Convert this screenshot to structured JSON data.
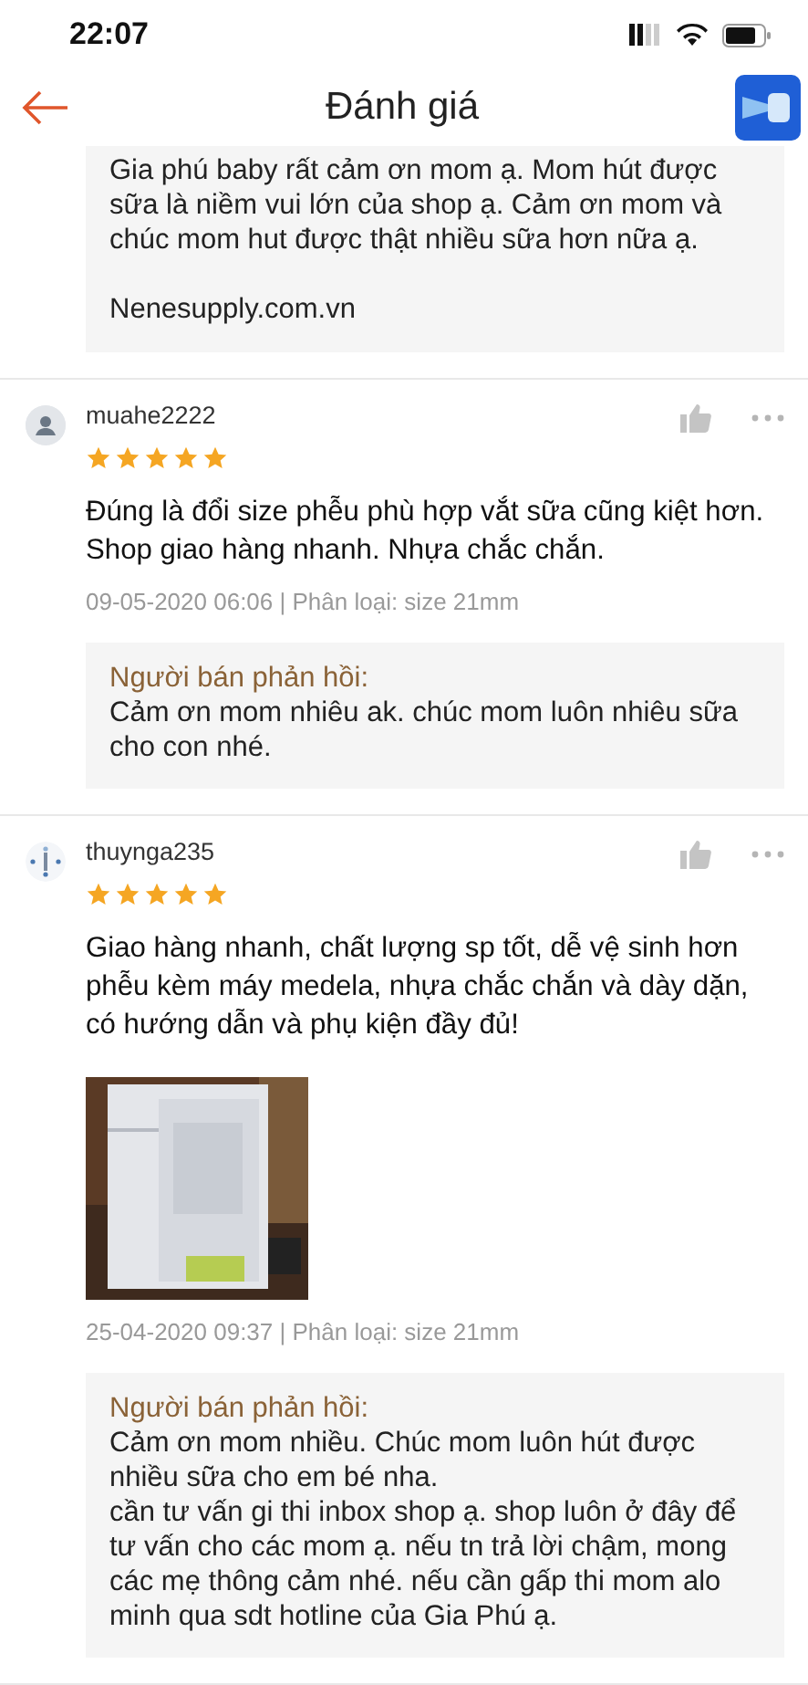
{
  "status_bar": {
    "time": "22:07"
  },
  "header": {
    "title": "Đánh giá"
  },
  "top_reply": {
    "text": "Gia phú baby rất cảm ơn mom ạ. Mom hút được sữa là niềm vui lớn của shop ạ. Cảm ơn mom và chúc mom hut được thật nhiều sữa hơn nữa ạ.\n\nNenesupply.com.vn"
  },
  "reviews": [
    {
      "user": "muahe2222",
      "avatar": {
        "kind": "default"
      },
      "stars": 5,
      "text": "Đúng là đổi size phễu phù hợp vắt sữa cũng kiệt hơn. Shop giao hàng nhanh. Nhựa chắc chắn.",
      "meta": "09-05-2020 06:06 | Phân loại: size 21mm",
      "reply": {
        "label": "Người bán phản hồi:",
        "text": "Cảm ơn mom nhiêu ak. chúc mom luôn nhiêu sữa cho con nhé."
      }
    },
    {
      "user": "thuynga235",
      "avatar": {
        "kind": "picture"
      },
      "stars": 5,
      "text": "Giao hàng nhanh, chất lượng sp tốt, dễ vệ sinh hơn phễu kèm máy medela, nhựa chắc chắn và dày dặn, có hướng dẫn và phụ kiện đầy đủ!",
      "photos": [
        {
          "kind": "picture"
        }
      ],
      "meta": "25-04-2020 09:37 | Phân loại: size 21mm",
      "reply": {
        "label": "Người bán phản hồi:",
        "text": "Cảm ơn mom nhiều. Chúc mom luôn hút được nhiều sữa cho em bé nha.\ncần tư vấn gi thi inbox shop ạ. shop luôn ở đây để tư vấn cho các mom ạ. nếu tn trả lời chậm, mong các mẹ thông cảm nhé. nếu cần gấp thi mom alo minh qua sdt hotline của Gia Phú ạ."
      }
    }
  ]
}
